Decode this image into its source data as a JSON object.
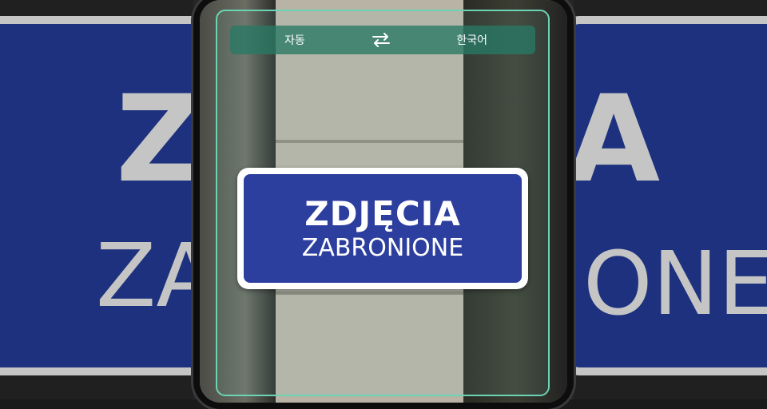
{
  "background": {
    "left_sign": {
      "line1": "Z",
      "line2": "ZA"
    },
    "right_sign": {
      "line1": "A",
      "line2": "ONE"
    }
  },
  "translator": {
    "source_language": "자동",
    "target_language": "한국어",
    "swap_icon": "swap-arrows-icon"
  },
  "sign": {
    "line1": "ZDJĘCIA",
    "line2": "ZABRONIONE"
  },
  "colors": {
    "accent": "#6bd4b4",
    "sign_blue": "#2c3e9e",
    "lang_bar": "#28786a"
  }
}
